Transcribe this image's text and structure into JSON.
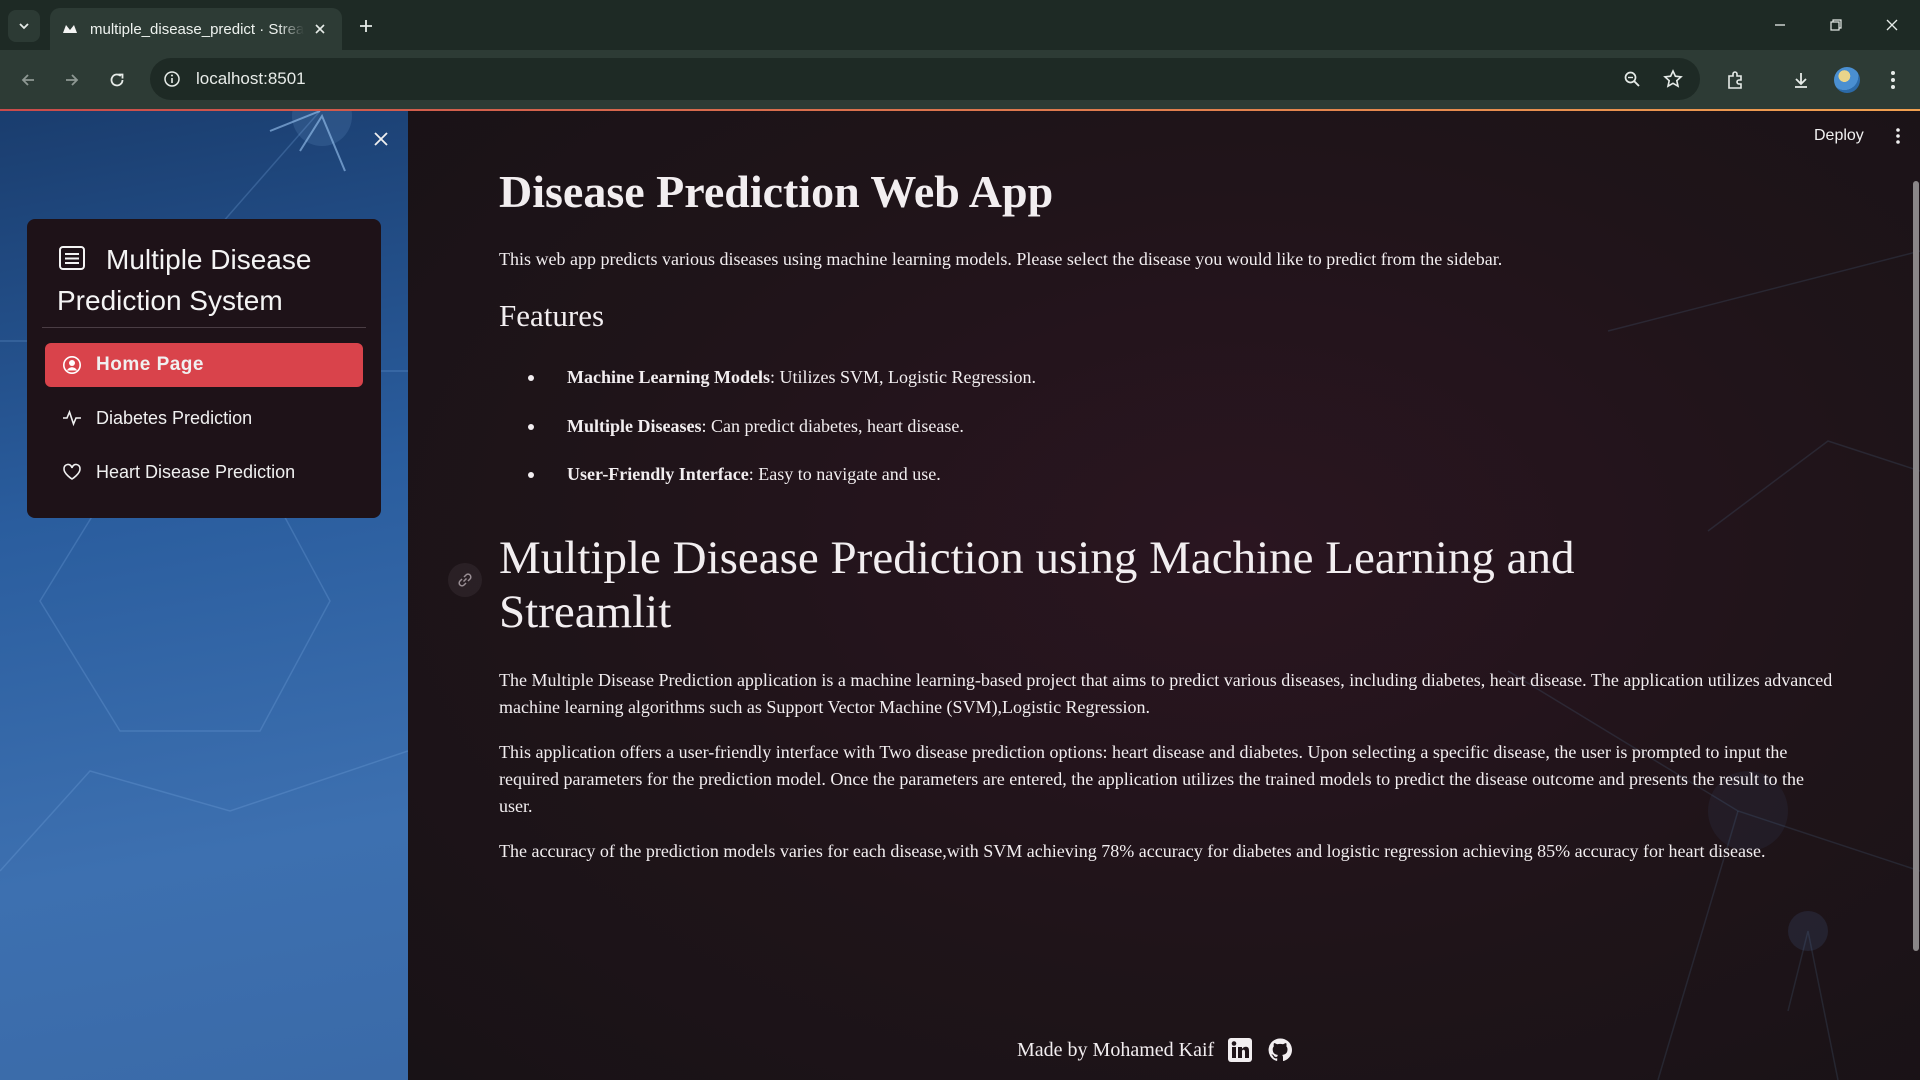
{
  "browser": {
    "tab_title": "multiple_disease_predict · Streamlit",
    "url": "localhost:8501"
  },
  "app": {
    "deploy_label": "Deploy"
  },
  "sidebar": {
    "menu_title": "Multiple Disease Prediction System",
    "items": [
      {
        "label": "Home Page",
        "icon": "person-circle-icon",
        "active": true
      },
      {
        "label": "Diabetes Prediction",
        "icon": "activity-icon",
        "active": false
      },
      {
        "label": "Heart Disease Prediction",
        "icon": "heart-icon",
        "active": false
      }
    ]
  },
  "main": {
    "title": "Disease Prediction Web App",
    "intro": "This web app predicts various diseases using machine learning models. Please select the disease you would like to predict from the sidebar.",
    "features_heading": "Features",
    "features": [
      {
        "bold": "Machine Learning Models",
        "text": ": Utilizes SVM, Logistic Regression."
      },
      {
        "bold": "Multiple Diseases",
        "text": ": Can predict diabetes, heart disease."
      },
      {
        "bold": "User-Friendly Interface",
        "text": ": Easy to navigate and use."
      }
    ],
    "section_heading": "Multiple Disease Prediction using Machine Learning and Streamlit",
    "paragraphs": [
      "The Multiple Disease Prediction application is a machine learning-based project that aims to predict various diseases, including diabetes, heart disease. The application utilizes advanced machine learning algorithms such as Support Vector Machine (SVM),Logistic Regression.",
      "This application offers a user-friendly interface with Two disease prediction options: heart disease and diabetes. Upon selecting a specific disease, the user is prompted to input the required parameters for the prediction model. Once the parameters are entered, the application utilizes the trained models to predict the disease outcome and presents the result to the user.",
      "The accuracy of the prediction models varies for each disease,with SVM achieving 78% accuracy for diabetes and logistic regression achieving 85% accuracy for heart disease."
    ],
    "footer": "Made by Mohamed Kaif"
  },
  "colors": {
    "accent": "#d9434b",
    "sidebar_top": "#1a3d6e",
    "sidebar_bottom": "#3a6aa8",
    "main_bg": "#1f1419"
  }
}
